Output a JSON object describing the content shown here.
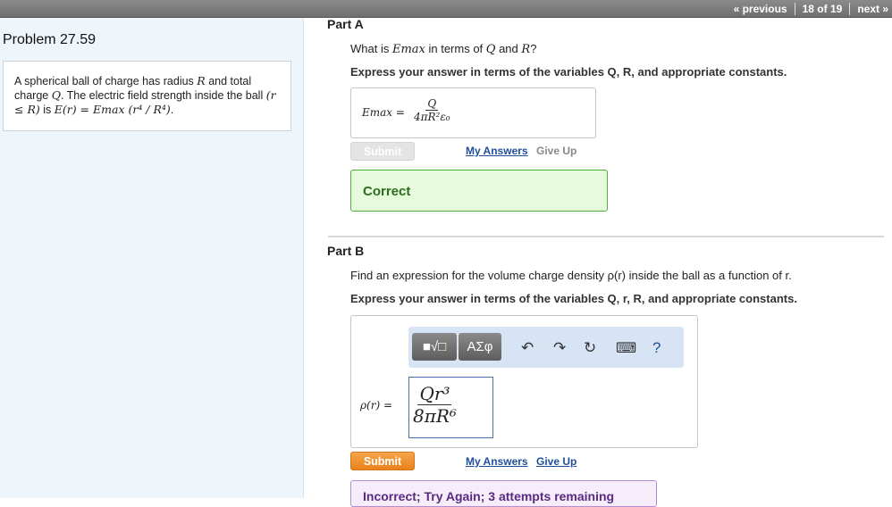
{
  "nav": {
    "previous": "« previous",
    "position": "18 of 19",
    "next": "next »"
  },
  "problem": {
    "title": "Problem 27.59",
    "text_prefix": "A spherical ball of charge has radius ",
    "sym_R": "R",
    "text_mid": " and total charge ",
    "sym_Q": "Q",
    "text_mid2": ". The electric field strength inside the ball ",
    "cond": "(r ≤ R)",
    "text_is": " is ",
    "formula": "E(r) = Emax (r⁴ / R⁴)",
    "end": "."
  },
  "partA": {
    "label": "Part A",
    "q_prefix": "What is ",
    "q_var": "Emax",
    "q_mid": " in terms of ",
    "q_Q": "Q",
    "q_and": " and ",
    "q_R": "R",
    "q_end": "?",
    "instruction": "Express your answer in terms of the variables Q, R, and appropriate constants.",
    "answer_lhs": "Emax =",
    "answer_num": "Q",
    "answer_den": "4πR²ε₀",
    "submit": "Submit",
    "my_answers": "My Answers",
    "give_up": "Give Up",
    "result": "Correct"
  },
  "partB": {
    "label": "Part B",
    "question": "Find an expression for the volume charge density ρ(r) inside the ball as a function of r.",
    "instruction": "Express your answer in terms of the variables Q, r, R, and appropriate constants.",
    "toolbar": {
      "templates": "■√□",
      "symbols": "ΑΣφ",
      "undo": "↶",
      "redo": "↷",
      "reset": "↻",
      "keyboard": "⌨",
      "help": "?"
    },
    "answer_lhs": "ρ(r) =",
    "answer_num": "Qr³",
    "answer_den": "8πR⁶",
    "submit": "Submit",
    "my_answers": "My Answers",
    "give_up": "Give Up",
    "feedback": "Incorrect; Try Again; 3 attempts remaining"
  },
  "colors": {
    "accent_orange": "#e9821c",
    "link_blue": "#1f4f9a",
    "correct_green": "#4caf3c",
    "left_panel": "#eef5fb"
  }
}
